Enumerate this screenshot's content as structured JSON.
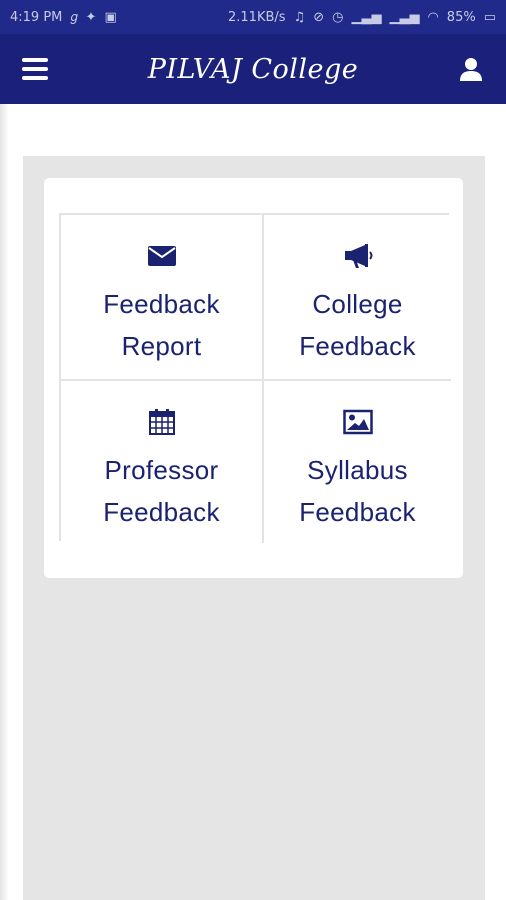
{
  "status_bar": {
    "time": "4:19 PM",
    "network_speed": "2.11KB/s",
    "battery": "85%"
  },
  "app_bar": {
    "title": "PILVAJ College",
    "menu_icon": "hamburger-menu-icon",
    "profile_icon": "user-icon"
  },
  "tiles": [
    {
      "icon": "envelope-icon",
      "line1": "Feedback",
      "line2": "Report"
    },
    {
      "icon": "megaphone-icon",
      "line1": "College",
      "line2": "Feedback"
    },
    {
      "icon": "calendar-icon",
      "line1": "Professor",
      "line2": "Feedback"
    },
    {
      "icon": "image-icon",
      "line1": "Syllabus",
      "line2": "Feedback"
    }
  ],
  "colors": {
    "status_bar": "#1f2a8a",
    "app_bar": "#1b217a",
    "tile_text": "#1b2270",
    "content_bg": "#e5e5e5"
  }
}
